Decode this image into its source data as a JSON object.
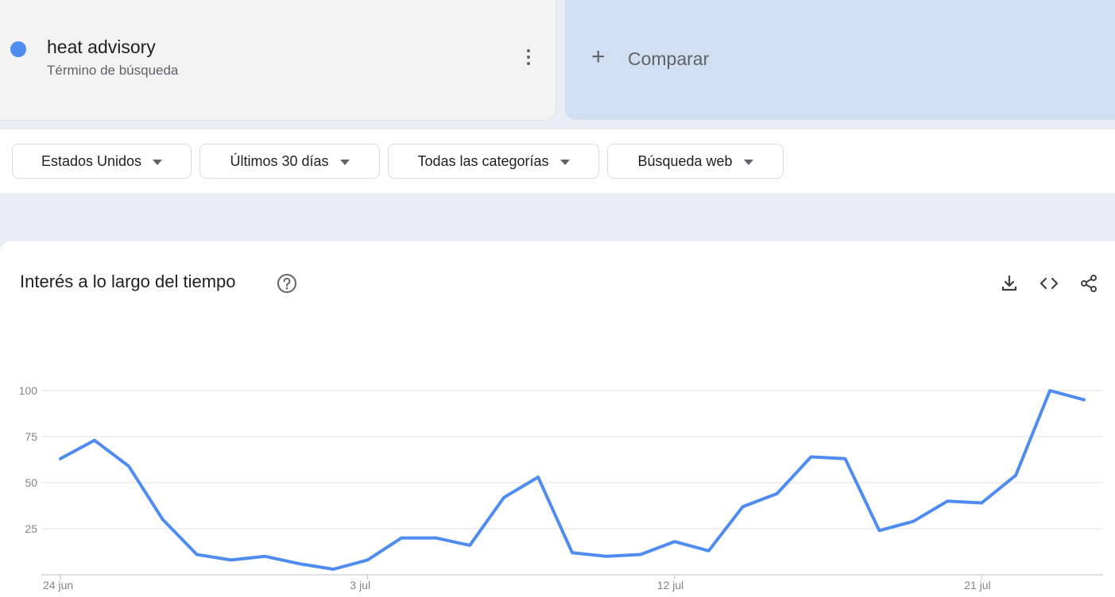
{
  "term": {
    "title": "heat advisory",
    "subtitle": "Término de búsqueda",
    "color": "#4f8cf1"
  },
  "compare": {
    "label": "Comparar"
  },
  "filters": {
    "region": "Estados Unidos",
    "period": "Últimos 30 días",
    "category": "Todas las categorías",
    "search_type": "Búsqueda web"
  },
  "chart_section": {
    "title": "Interés a lo largo del tiempo"
  },
  "icons": {
    "help": "help-circle-icon",
    "download": "download-icon",
    "embed": "embed-code-icon",
    "share": "share-icon"
  },
  "chart_data": {
    "type": "line",
    "title": "",
    "xlabel": "",
    "ylabel": "",
    "ylim": [
      0,
      100
    ],
    "y_ticks": [
      25,
      50,
      75,
      100
    ],
    "grid": true,
    "line_color": "#4f8cf1",
    "x": [
      "24 jun",
      "25 jun",
      "26 jun",
      "27 jun",
      "28 jun",
      "29 jun",
      "30 jun",
      "1 jul",
      "2 jul",
      "3 jul",
      "4 jul",
      "5 jul",
      "6 jul",
      "7 jul",
      "8 jul",
      "9 jul",
      "10 jul",
      "11 jul",
      "12 jul",
      "13 jul",
      "14 jul",
      "15 jul",
      "16 jul",
      "17 jul",
      "18 jul",
      "19 jul",
      "20 jul",
      "21 jul",
      "22 jul",
      "23 jul",
      "24 jul"
    ],
    "x_tick_labels": [
      {
        "index": 0,
        "label": "24 jun"
      },
      {
        "index": 9,
        "label": "3 jul"
      },
      {
        "index": 18,
        "label": "12 jul"
      },
      {
        "index": 27,
        "label": "21 jul"
      }
    ],
    "series": [
      {
        "values": [
          63,
          73,
          59,
          30,
          11,
          8,
          10,
          6,
          3,
          8,
          20,
          20,
          16,
          42,
          53,
          12,
          10,
          11,
          18,
          13,
          37,
          44,
          64,
          63,
          24,
          29,
          40,
          39,
          54,
          100,
          95
        ]
      }
    ]
  }
}
